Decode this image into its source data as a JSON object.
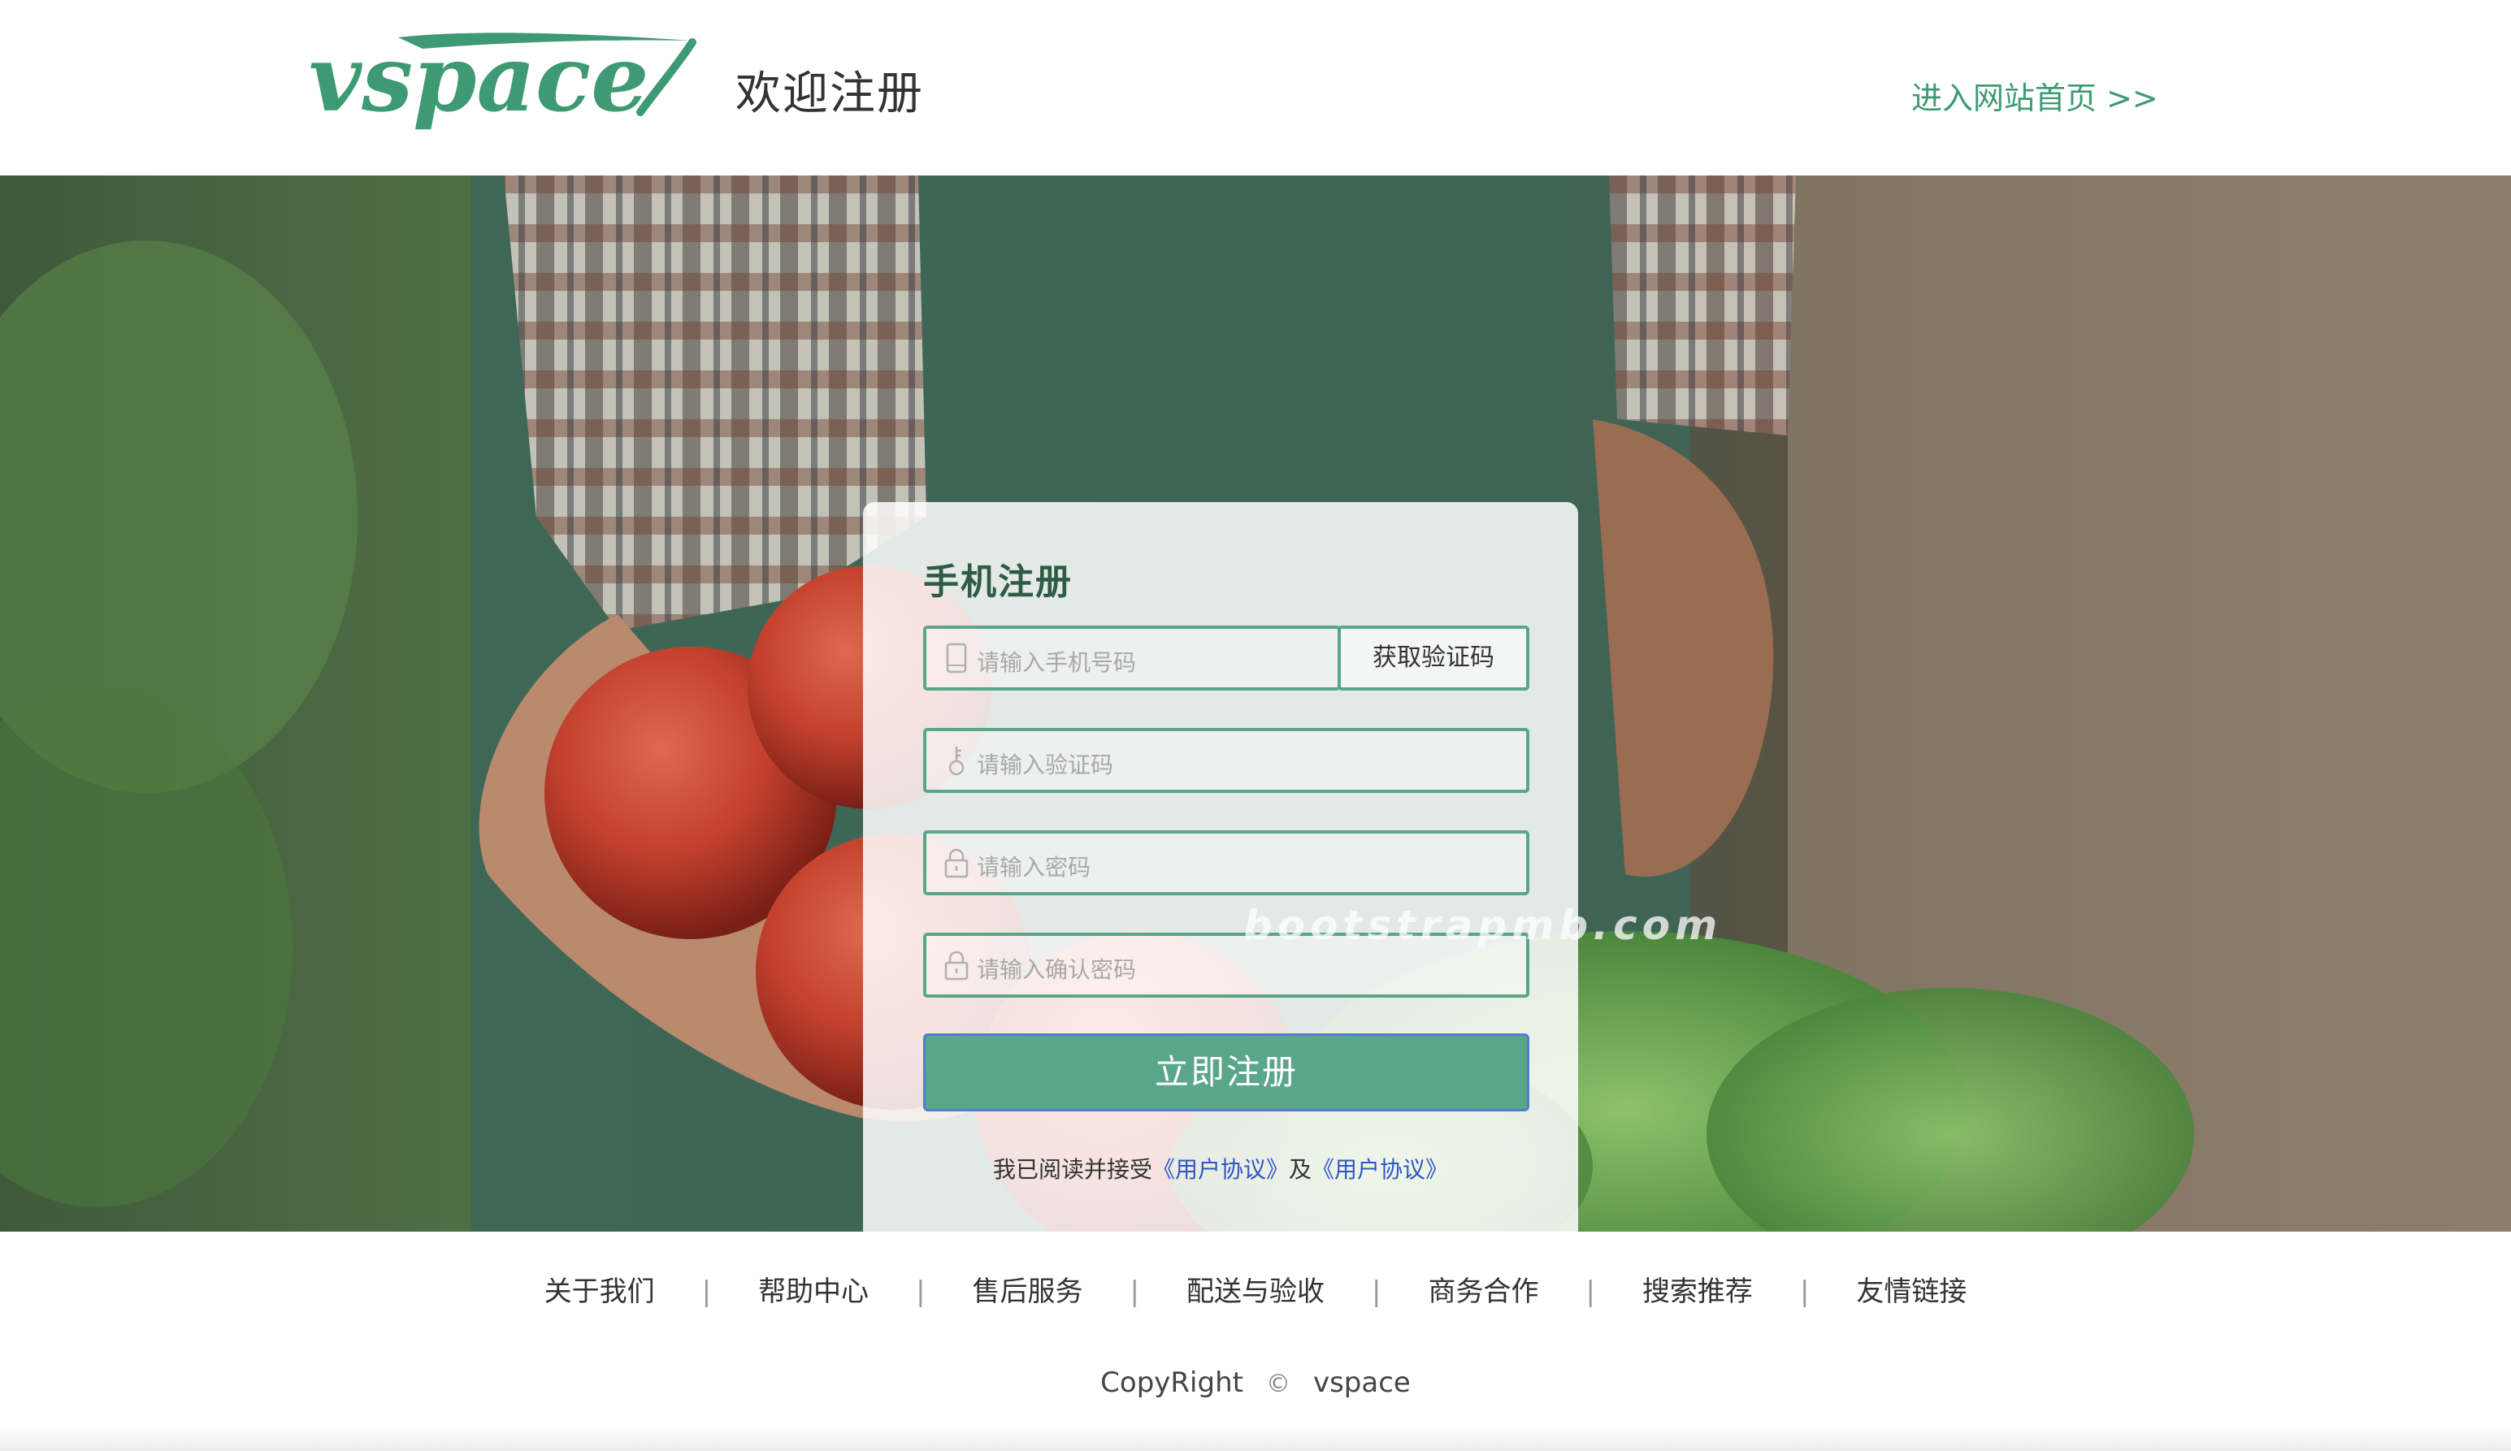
{
  "header": {
    "logo_text": "vspace",
    "page_heading": "欢迎注册",
    "home_link": "进入网站首页 >>"
  },
  "register_form": {
    "title": "手机注册",
    "phone_placeholder": "请输入手机号码",
    "get_code_label": "获取验证码",
    "code_placeholder": "请输入验证码",
    "password_placeholder": "请输入密码",
    "confirm_placeholder": "请输入确认密码",
    "submit_label": "立即注册",
    "agreement": {
      "prefix": "我已阅读并接受",
      "link1": "《用户协议》",
      "middle": "及",
      "link2": "《用户协议》"
    }
  },
  "watermark": "bootstrapmb.com",
  "footer": {
    "links": [
      "关于我们",
      "帮助中心",
      "售后服务",
      "配送与验收",
      "商务合作",
      "搜索推荐",
      "友情链接"
    ],
    "separator": "|",
    "copyright_left": "CopyRight",
    "copyright_symbol": "©",
    "copyright_right": "vspace"
  },
  "colors": {
    "accent": "#5aa68a",
    "brand_green": "#3d9a73",
    "link_blue": "#2f55c6"
  },
  "icons": {
    "phone": "mobile-phone-icon",
    "code": "key-icon",
    "password": "lock-icon",
    "confirm": "lock-icon"
  }
}
